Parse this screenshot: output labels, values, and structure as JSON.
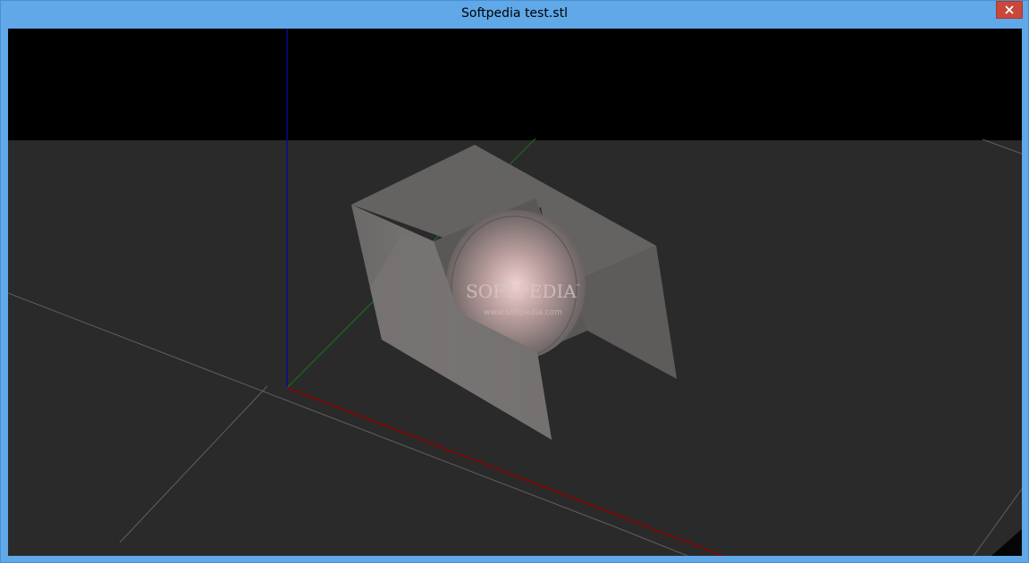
{
  "window": {
    "title": "Softpedia test.stl",
    "close_icon": "close-icon"
  },
  "viewport": {
    "background_color": "#000000",
    "ground_color": "#2a2a2a",
    "model_color": "#6a6666",
    "axis_colors": {
      "x": "#8b0000",
      "y": "#1c6b1c",
      "z": "#0a0a8c"
    },
    "watermark": {
      "brand": "SOFTPEDIA",
      "trademark": "™",
      "url": "www.softpedia.com"
    }
  }
}
